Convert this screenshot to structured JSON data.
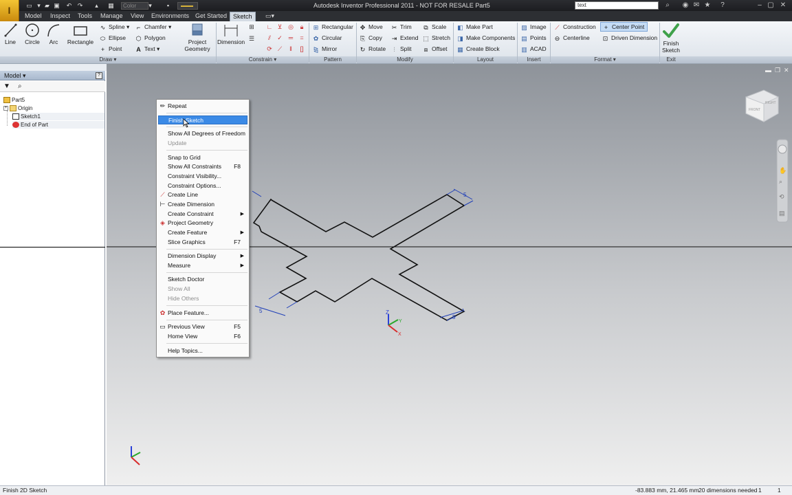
{
  "titlebar": {
    "app_title": "Autodesk Inventor Professional 2011 - NOT FOR RESALE   Part5",
    "color_placeholder": "Color",
    "search_value": "text"
  },
  "tabs": [
    {
      "label": "Model"
    },
    {
      "label": "Inspect"
    },
    {
      "label": "Tools"
    },
    {
      "label": "Manage"
    },
    {
      "label": "View"
    },
    {
      "label": "Environments"
    },
    {
      "label": "Get Started"
    },
    {
      "label": "Sketch"
    }
  ],
  "ribbon": {
    "draw": {
      "line": "Line",
      "circle": "Circle",
      "arc": "Arc",
      "rectangle": "Rectangle",
      "spline": "Spline",
      "ellipse": "Ellipse",
      "point": "Point",
      "chamfer": "Chamfer",
      "polygon": "Polygon",
      "text": "Text",
      "project_geometry_1": "Project",
      "project_geometry_2": "Geometry",
      "panel": "Draw"
    },
    "constrain": {
      "dimension": "Dimension",
      "panel": "Constrain"
    },
    "pattern": {
      "rectangular": "Rectangular",
      "circular": "Circular",
      "mirror": "Mirror",
      "panel": "Pattern"
    },
    "modify": {
      "move": "Move",
      "trim": "Trim",
      "scale": "Scale",
      "copy": "Copy",
      "extend": "Extend",
      "stretch": "Stretch",
      "rotate": "Rotate",
      "split": "Split",
      "offset": "Offset",
      "panel": "Modify"
    },
    "layout": {
      "make_part": "Make Part",
      "make_components": "Make Components",
      "create_block": "Create Block",
      "panel": "Layout"
    },
    "insert": {
      "image": "Image",
      "points": "Points",
      "acad": "ACAD",
      "panel": "Insert"
    },
    "format": {
      "construction": "Construction",
      "center_point": "Center Point",
      "centerline": "Centerline",
      "driven_dimension": "Driven Dimension",
      "panel": "Format"
    },
    "exit": {
      "finish_1": "Finish",
      "finish_2": "Sketch",
      "panel": "Exit"
    }
  },
  "browser": {
    "title": "Model",
    "items": [
      {
        "label": "Part5"
      },
      {
        "label": "Origin"
      },
      {
        "label": "Sketch1"
      },
      {
        "label": "End of Part"
      }
    ]
  },
  "context_menu": {
    "items": [
      {
        "label": "Repeat",
        "shortcut": ""
      },
      {
        "label": "Finish Sketch",
        "shortcut": ""
      },
      {
        "label": "Show All Degrees of Freedom",
        "shortcut": ""
      },
      {
        "label": "Update",
        "shortcut": ""
      },
      {
        "label": "Snap to Grid",
        "shortcut": ""
      },
      {
        "label": "Show All Constraints",
        "shortcut": "F8"
      },
      {
        "label": "Constraint Visibility...",
        "shortcut": ""
      },
      {
        "label": "Constraint Options...",
        "shortcut": ""
      },
      {
        "label": "Create Line",
        "shortcut": ""
      },
      {
        "label": "Create Dimension",
        "shortcut": ""
      },
      {
        "label": "Create Constraint",
        "shortcut": ""
      },
      {
        "label": "Project Geometry",
        "shortcut": ""
      },
      {
        "label": "Create Feature",
        "shortcut": ""
      },
      {
        "label": "Slice Graphics",
        "shortcut": "F7"
      },
      {
        "label": "Dimension Display",
        "shortcut": ""
      },
      {
        "label": "Measure",
        "shortcut": ""
      },
      {
        "label": "Sketch Doctor",
        "shortcut": ""
      },
      {
        "label": "Show All",
        "shortcut": ""
      },
      {
        "label": "Hide Others",
        "shortcut": ""
      },
      {
        "label": "Place Feature...",
        "shortcut": ""
      },
      {
        "label": "Previous View",
        "shortcut": "F5"
      },
      {
        "label": "Home View",
        "shortcut": "F6"
      },
      {
        "label": "Help Topics...",
        "shortcut": ""
      }
    ]
  },
  "viewport": {
    "dim_labels": [
      "5",
      "5",
      "5"
    ],
    "triad_x": "X",
    "triad_y": "Y",
    "triad_z": "Z",
    "viewcube_front": "FRONT",
    "viewcube_right": "RIGHT"
  },
  "status": {
    "left": "Finish 2D Sketch",
    "coords": "-83.883 mm, 21.465 mm",
    "dims": "20 dimensions needed",
    "n1": "1",
    "n2": "1"
  },
  "colors": {
    "accent": "#3b8ae6",
    "check_green": "#3fa14a"
  }
}
